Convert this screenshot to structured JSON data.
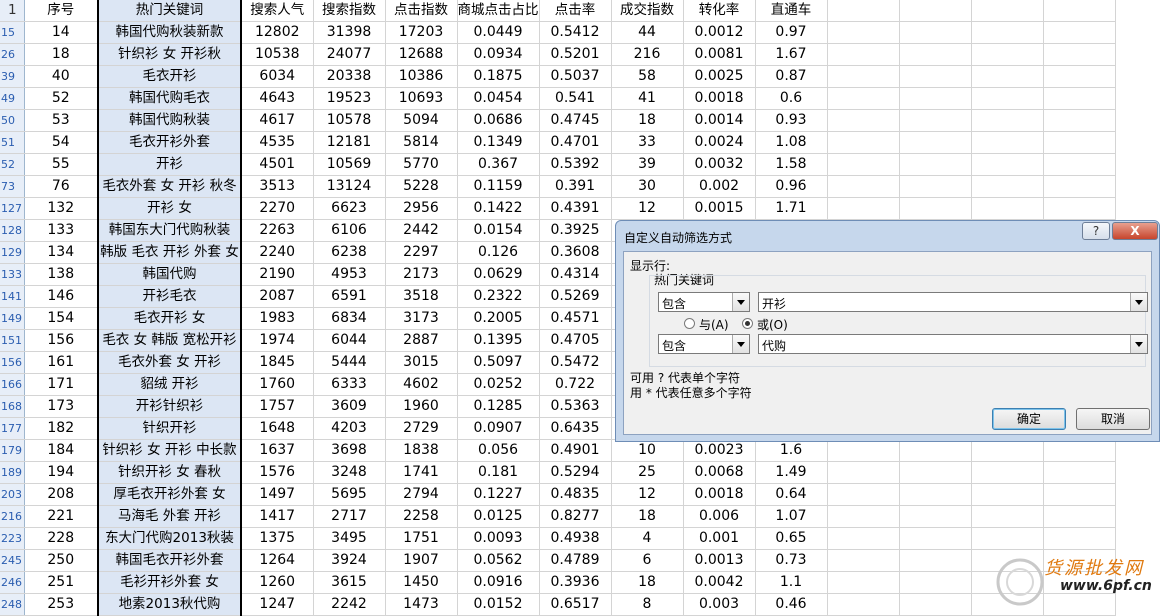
{
  "columns": [
    "序号",
    "热门关键词",
    "搜索人气",
    "搜索指数",
    "点击指数",
    "商城点击占比",
    "点击率",
    "成交指数",
    "转化率",
    "直通车"
  ],
  "header_row_number": "1",
  "rows": [
    {
      "r": "15",
      "c": [
        "14",
        "韩国代购秋装新款",
        "12802",
        "31398",
        "17203",
        "0.0449",
        "0.5412",
        "44",
        "0.0012",
        "0.97"
      ]
    },
    {
      "r": "26",
      "c": [
        "18",
        "针织衫 女 开衫秋",
        "10538",
        "24077",
        "12688",
        "0.0934",
        "0.5201",
        "216",
        "0.0081",
        "1.67"
      ]
    },
    {
      "r": "39",
      "c": [
        "40",
        "毛衣开衫",
        "6034",
        "20338",
        "10386",
        "0.1875",
        "0.5037",
        "58",
        "0.0025",
        "0.87"
      ]
    },
    {
      "r": "49",
      "c": [
        "52",
        "韩国代购毛衣",
        "4643",
        "19523",
        "10693",
        "0.0454",
        "0.541",
        "41",
        "0.0018",
        "0.6"
      ]
    },
    {
      "r": "50",
      "c": [
        "53",
        "韩国代购秋装",
        "4617",
        "10578",
        "5094",
        "0.0686",
        "0.4745",
        "18",
        "0.0014",
        "0.93"
      ]
    },
    {
      "r": "51",
      "c": [
        "54",
        "毛衣开衫外套",
        "4535",
        "12181",
        "5814",
        "0.1349",
        "0.4701",
        "33",
        "0.0024",
        "1.08"
      ]
    },
    {
      "r": "52",
      "c": [
        "55",
        "开衫",
        "4501",
        "10569",
        "5770",
        "0.367",
        "0.5392",
        "39",
        "0.0032",
        "1.58"
      ]
    },
    {
      "r": "73",
      "c": [
        "76",
        "毛衣外套 女 开衫 秋冬",
        "3513",
        "13124",
        "5228",
        "0.1159",
        "0.391",
        "30",
        "0.002",
        "0.96"
      ]
    },
    {
      "r": "127",
      "c": [
        "132",
        "开衫 女",
        "2270",
        "6623",
        "2956",
        "0.1422",
        "0.4391",
        "12",
        "0.0015",
        "1.71"
      ]
    },
    {
      "r": "128",
      "c": [
        "133",
        "韩国东大门代购秋装",
        "2263",
        "6106",
        "2442",
        "0.0154",
        "0.3925",
        "",
        "",
        ""
      ]
    },
    {
      "r": "129",
      "c": [
        "134",
        "韩版 毛衣 开衫 外套 女",
        "2240",
        "6238",
        "2297",
        "0.126",
        "0.3608",
        "",
        "",
        ""
      ]
    },
    {
      "r": "133",
      "c": [
        "138",
        "韩国代购",
        "2190",
        "4953",
        "2173",
        "0.0629",
        "0.4314",
        "",
        "",
        ""
      ]
    },
    {
      "r": "141",
      "c": [
        "146",
        "开衫毛衣",
        "2087",
        "6591",
        "3518",
        "0.2322",
        "0.5269",
        "",
        "",
        ""
      ]
    },
    {
      "r": "149",
      "c": [
        "154",
        "毛衣开衫 女",
        "1983",
        "6834",
        "3173",
        "0.2005",
        "0.4571",
        "",
        "",
        ""
      ]
    },
    {
      "r": "151",
      "c": [
        "156",
        "毛衣 女 韩版 宽松开衫",
        "1974",
        "6044",
        "2887",
        "0.1395",
        "0.4705",
        "",
        "",
        ""
      ]
    },
    {
      "r": "156",
      "c": [
        "161",
        "毛衣外套 女 开衫",
        "1845",
        "5444",
        "3015",
        "0.5097",
        "0.5472",
        "",
        "",
        ""
      ]
    },
    {
      "r": "166",
      "c": [
        "171",
        "貂绒 开衫",
        "1760",
        "6333",
        "4602",
        "0.0252",
        "0.722",
        "",
        "",
        ""
      ]
    },
    {
      "r": "168",
      "c": [
        "173",
        "开衫针织衫",
        "1757",
        "3609",
        "1960",
        "0.1285",
        "0.5363",
        "",
        "",
        ""
      ]
    },
    {
      "r": "177",
      "c": [
        "182",
        "针织开衫",
        "1648",
        "4203",
        "2729",
        "0.0907",
        "0.6435",
        "",
        "",
        ""
      ]
    },
    {
      "r": "179",
      "c": [
        "184",
        "针织衫 女 开衫 中长款",
        "1637",
        "3698",
        "1838",
        "0.056",
        "0.4901",
        "10",
        "0.0023",
        "1.6"
      ]
    },
    {
      "r": "189",
      "c": [
        "194",
        "针织开衫 女 春秋",
        "1576",
        "3248",
        "1741",
        "0.181",
        "0.5294",
        "25",
        "0.0068",
        "1.49"
      ]
    },
    {
      "r": "203",
      "c": [
        "208",
        "厚毛衣开衫外套 女",
        "1497",
        "5695",
        "2794",
        "0.1227",
        "0.4835",
        "12",
        "0.0018",
        "0.64"
      ]
    },
    {
      "r": "216",
      "c": [
        "221",
        "马海毛 外套 开衫",
        "1417",
        "2717",
        "2258",
        "0.0125",
        "0.8277",
        "18",
        "0.006",
        "1.07"
      ]
    },
    {
      "r": "223",
      "c": [
        "228",
        "东大门代购2013秋装",
        "1375",
        "3495",
        "1751",
        "0.0093",
        "0.4938",
        "4",
        "0.001",
        "0.65"
      ]
    },
    {
      "r": "245",
      "c": [
        "250",
        "韩国毛衣开衫外套",
        "1264",
        "3924",
        "1907",
        "0.0562",
        "0.4789",
        "6",
        "0.0013",
        "0.73"
      ]
    },
    {
      "r": "246",
      "c": [
        "251",
        "毛衫开衫外套 女",
        "1260",
        "3615",
        "1450",
        "0.0916",
        "0.3936",
        "18",
        "0.0042",
        "1.1"
      ]
    },
    {
      "r": "248",
      "c": [
        "253",
        "地素2013秋代购",
        "1247",
        "2242",
        "1473",
        "0.0152",
        "0.6517",
        "8",
        "0.003",
        "0.46"
      ]
    }
  ],
  "dialog": {
    "title": "自定义自动筛选方式",
    "help_label": "?",
    "close_label": "X",
    "show_rows_label": "显示行:",
    "field_label": "热门关键词",
    "cond1": {
      "operator": "包含",
      "value": "开衫"
    },
    "and_label": "与(A)",
    "or_label": "或(O)",
    "selected_logic": "or",
    "cond2": {
      "operator": "包含",
      "value": "代购"
    },
    "hint1": "可用 ? 代表单个字符",
    "hint2": "用 * 代表任意多个字符",
    "ok_label": "确定",
    "cancel_label": "取消"
  },
  "watermark": {
    "line1": "货源批发网",
    "line2": "www.6pf.cn"
  },
  "colors": {
    "keyword_column": "#dce6f4",
    "row_header": "#e7eef8",
    "dialog_frame": "#c6d7ec",
    "close_button": "#c7452d"
  }
}
